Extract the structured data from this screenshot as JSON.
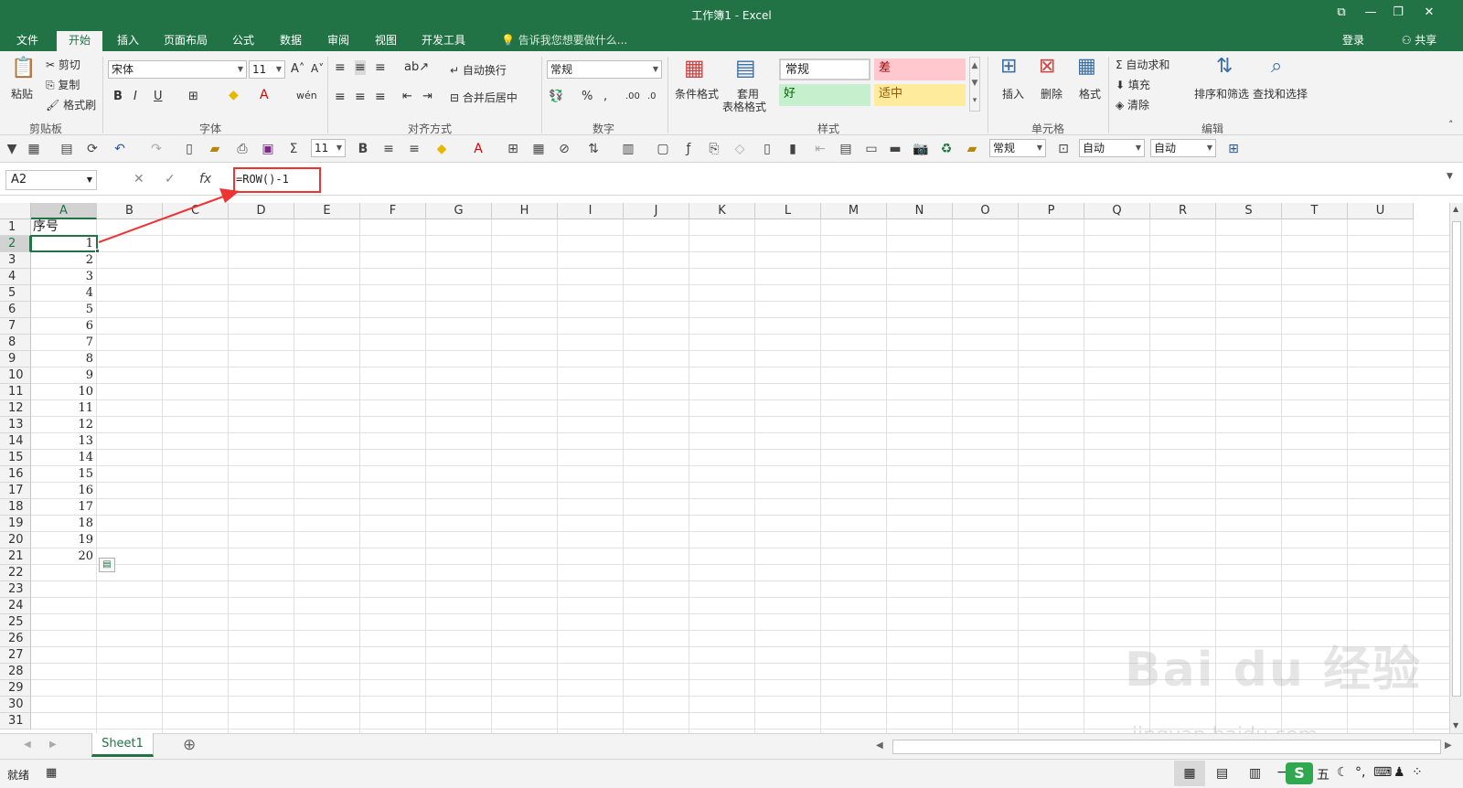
{
  "window": {
    "title": "工作簿1 - Excel",
    "controls": [
      "⧉",
      "—",
      "❐",
      "✕"
    ]
  },
  "tabs": [
    "文件",
    "开始",
    "插入",
    "页面布局",
    "公式",
    "数据",
    "审阅",
    "视图",
    "开发工具"
  ],
  "tell_me": "告诉我您想要做什么...",
  "account": {
    "login": "登录",
    "share": "共享"
  },
  "ribbon": {
    "clipboard": {
      "paste": "粘贴",
      "cut": "剪切",
      "copy": "复制",
      "format_painter": "格式刷",
      "label": "剪贴板"
    },
    "font": {
      "name": "宋体",
      "size": "11",
      "label": "字体"
    },
    "align": {
      "wrap": "自动换行",
      "merge": "合并后居中",
      "label": "对齐方式"
    },
    "number": {
      "format": "常规",
      "label": "数字"
    },
    "styles": {
      "cond": "条件格式",
      "table1": "套用",
      "table2": "表格格式",
      "normal": "常规",
      "bad": "差",
      "good": "好",
      "neutral": "适中",
      "label": "样式"
    },
    "cells": {
      "insert": "插入",
      "delete": "删除",
      "format": "格式",
      "label": "单元格"
    },
    "editing": {
      "autosum": "自动求和",
      "fill": "填充",
      "clear": "清除",
      "sort": "排序和筛选",
      "find": "查找和选择",
      "label": "编辑"
    }
  },
  "qat": {
    "size": "11",
    "format": "常规",
    "auto1": "自动",
    "auto2": "自动"
  },
  "formula_bar": {
    "name_box": "A2",
    "cancel": "✕",
    "enter": "✓",
    "fx": "fx",
    "formula": "=ROW()-1"
  },
  "columns": [
    "A",
    "B",
    "C",
    "D",
    "E",
    "F",
    "G",
    "H",
    "I",
    "J",
    "K",
    "L",
    "M",
    "N",
    "O",
    "P",
    "Q",
    "R",
    "S",
    "T",
    "U"
  ],
  "rows": [
    "1",
    "2",
    "3",
    "4",
    "5",
    "6",
    "7",
    "8",
    "9",
    "10",
    "11",
    "12",
    "13",
    "14",
    "15",
    "16",
    "17",
    "18",
    "19",
    "20",
    "21",
    "22",
    "23",
    "24",
    "25",
    "26",
    "27",
    "28",
    "29",
    "30",
    "31"
  ],
  "cells": {
    "A1": "序号",
    "values": [
      "1",
      "2",
      "3",
      "4",
      "5",
      "6",
      "7",
      "8",
      "9",
      "10",
      "11",
      "12",
      "13",
      "14",
      "15",
      "16",
      "17",
      "18",
      "19",
      "20"
    ]
  },
  "sheet": {
    "name": "Sheet1",
    "add": "⊕"
  },
  "status": {
    "ready": "就绪"
  },
  "watermark": {
    "main": "Bai du 经验",
    "sub": "jingyan.baidu.com"
  }
}
